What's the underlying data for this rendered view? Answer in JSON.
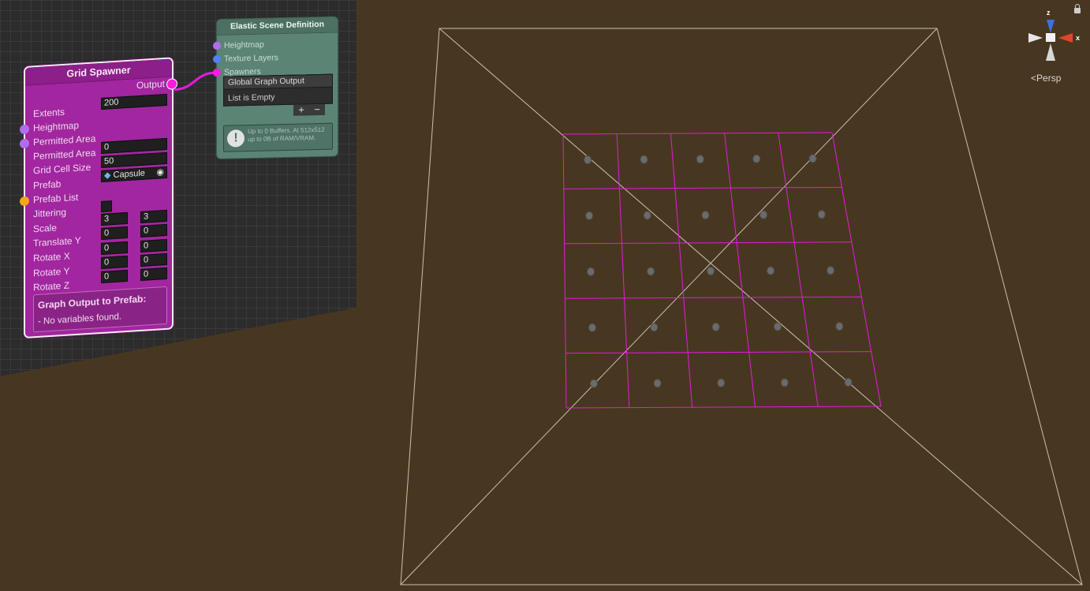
{
  "grid_spawner": {
    "title": "Grid Spawner",
    "output_label": "Output",
    "extents_label": "Extents",
    "extents_value": "200",
    "heightmap_label": "Heightmap",
    "permitted_area_label": "Permitted Area",
    "permitted_area2_label": "Permitted Area",
    "permitted_area2_value": "0",
    "grid_cell_size_label": "Grid Cell Size",
    "grid_cell_size_value": "50",
    "prefab_label": "Prefab",
    "prefab_value": "Capsule",
    "prefab_list_label": "Prefab List",
    "jittering_label": "Jittering",
    "scale_label": "Scale",
    "scale_min": "3",
    "scale_max": "3",
    "translate_y_label": "Translate Y",
    "translate_y_min": "0",
    "translate_y_max": "0",
    "rotate_x_label": "Rotate X",
    "rotate_x_min": "0",
    "rotate_x_max": "0",
    "rotate_y_label": "Rotate Y",
    "rotate_y_min": "0",
    "rotate_y_max": "0",
    "rotate_z_label": "Rotate Z",
    "rotate_z_min": "0",
    "rotate_z_max": "0",
    "graph_output_heading": "Graph Output to Prefab:",
    "graph_output_text": "- No variables found."
  },
  "elastic_scene": {
    "title": "Elastic Scene Definition",
    "heightmap_label": "Heightmap",
    "texture_layers_label": "Texture Layers",
    "spawners_label": "Spawners",
    "list_header": "Global Graph Output",
    "list_empty": "List is Empty",
    "add_label": "+",
    "remove_label": "−",
    "warning_text": "Up to 0 Buffers. At 512x512 up to 0B of RAM/VRAM."
  },
  "gizmo": {
    "persp_label": "Persp",
    "z_label": "z",
    "x_label": "x"
  },
  "viewport": {
    "spawn_grid_rows": 5,
    "spawn_grid_cols": 5
  },
  "colors": {
    "viewport_bg": "#483720",
    "node_spawner": "#a2269f",
    "node_scene": "#5b8475",
    "wire": "#e21be0",
    "port_purple": "#b06df0",
    "port_blue": "#4f7fff",
    "port_magenta": "#ff1adf",
    "port_orange": "#f4a61c"
  }
}
